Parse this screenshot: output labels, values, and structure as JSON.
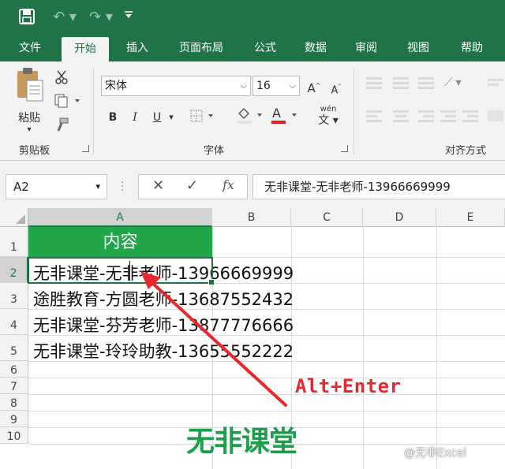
{
  "quick_access": {
    "save_icon": "save-icon",
    "undo_icon": "undo-icon",
    "redo_icon": "redo-icon",
    "customize_icon": "customize-icon"
  },
  "tabs": [
    {
      "label": "文件"
    },
    {
      "label": "开始"
    },
    {
      "label": "插入"
    },
    {
      "label": "页面布局"
    },
    {
      "label": "公式"
    },
    {
      "label": "数据"
    },
    {
      "label": "审阅"
    },
    {
      "label": "视图"
    },
    {
      "label": "帮助"
    }
  ],
  "active_tab": "开始",
  "ribbon": {
    "clipboard": {
      "paste_label": "粘贴",
      "group_label": "剪贴板"
    },
    "font": {
      "font_name": "宋体",
      "font_size": "16",
      "bold": "B",
      "italic": "I",
      "underline": "U",
      "phonetic": "wén",
      "group_label": "字体"
    },
    "alignment": {
      "group_label": "对齐方式"
    }
  },
  "formula_bar": {
    "name_box": "A2",
    "formula_value": "无非课堂-无非老师-13966669999"
  },
  "grid": {
    "columns": [
      "A",
      "B",
      "C",
      "D",
      "E"
    ],
    "rows": [
      "1",
      "2",
      "3",
      "4",
      "5",
      "6",
      "7",
      "8",
      "9",
      "10"
    ],
    "header_cell": "内容",
    "cells": [
      "无非课堂-无非老师-13966669999",
      "途胜教育-方圆老师-13687552432",
      "无非课堂-芬芳老师-13877776666",
      "无非课堂-玲玲助教-13655552222"
    ]
  },
  "annotation": "Alt+Enter",
  "logo_text": "无非课堂",
  "watermark": "@无非Excel",
  "colors": {
    "ribbon_green": "#1f7346",
    "header_fill": "#21a649",
    "annotation_red": "#e8282c",
    "logo_green": "#1aa04b"
  }
}
